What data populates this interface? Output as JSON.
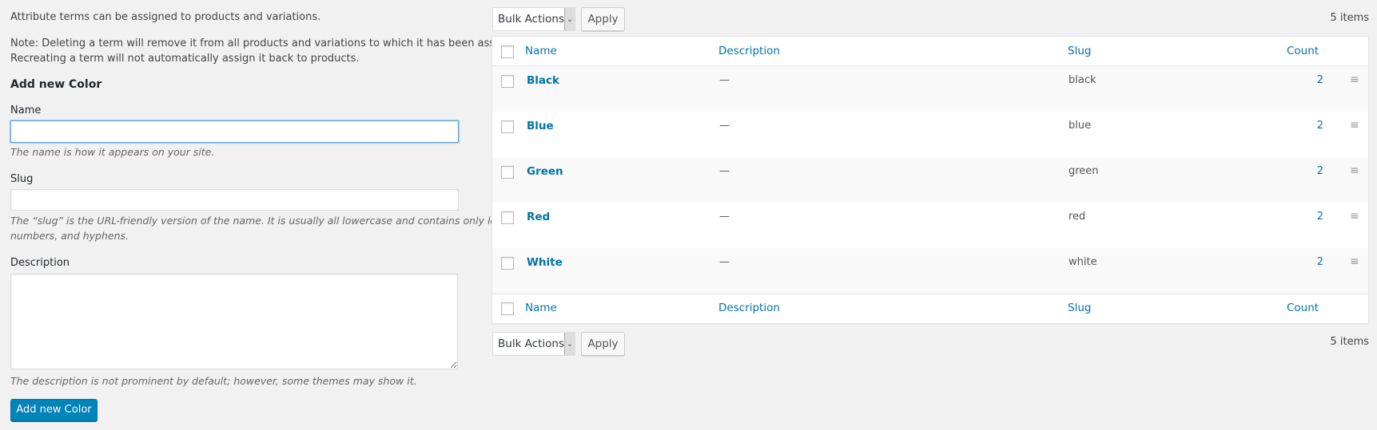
{
  "intro": {
    "line1": "Attribute terms can be assigned to products and variations.",
    "note1": "Note: Deleting a term will remove it from all products and variations to which it has been assigned.",
    "note2": "Recreating a term will not automatically assign it back to products."
  },
  "form": {
    "title": "Add new Color",
    "name_label": "Name",
    "name_value": "",
    "name_hint": "The name is how it appears on your site.",
    "slug_label": "Slug",
    "slug_value": "",
    "slug_hint1": "The “slug” is the URL-friendly version of the name. It is usually all lowercase and contains only letters,",
    "slug_hint2": "numbers, and hyphens.",
    "description_label": "Description",
    "description_value": "",
    "description_hint": "The description is not prominent by default; however, some themes may show it.",
    "submit_label": "Add new Color"
  },
  "bulk_top": {
    "selected": "Bulk Actions",
    "apply": "Apply",
    "count": "5 items"
  },
  "bulk_bottom": {
    "selected": "Bulk Actions",
    "apply": "Apply",
    "count": "5 items"
  },
  "table": {
    "columns": {
      "name": "Name",
      "description": "Description",
      "slug": "Slug",
      "count": "Count"
    },
    "rows": [
      {
        "name": "Black",
        "description": "—",
        "slug": "black",
        "count": "2"
      },
      {
        "name": "Blue",
        "description": "—",
        "slug": "blue",
        "count": "2"
      },
      {
        "name": "Green",
        "description": "—",
        "slug": "green",
        "count": "2"
      },
      {
        "name": "Red",
        "description": "—",
        "slug": "red",
        "count": "2"
      },
      {
        "name": "White",
        "description": "—",
        "slug": "white",
        "count": "2"
      }
    ]
  },
  "icons": {
    "select_arrow": "chevron-down-icon",
    "drag_handle": "menu-lines-icon"
  },
  "colors": {
    "link": "#0073aa",
    "primary": "#0085ba",
    "background": "#f1f1f1"
  }
}
